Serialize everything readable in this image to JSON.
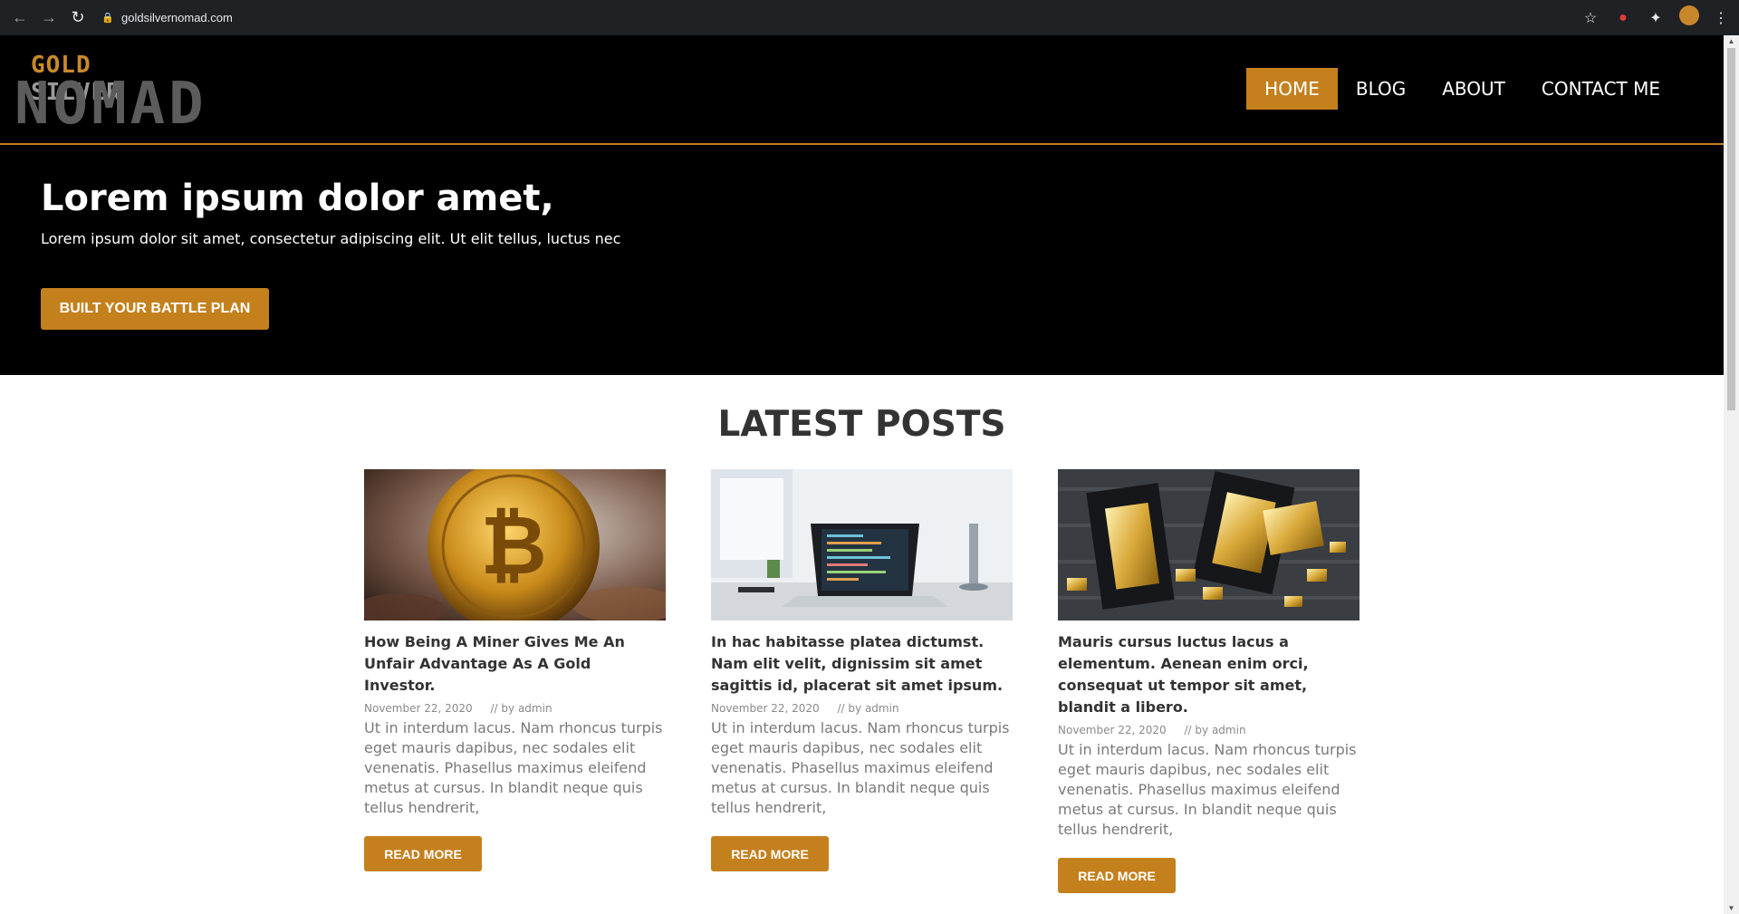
{
  "browser": {
    "url": "goldsilvernomad.com"
  },
  "logo": {
    "word1": "GOLD",
    "word2": "SILVER",
    "word3": "NOMAD"
  },
  "nav": {
    "items": [
      {
        "label": "HOME",
        "active": true
      },
      {
        "label": "BLOG",
        "active": false
      },
      {
        "label": "ABOUT",
        "active": false
      },
      {
        "label": "CONTACT ME",
        "active": false
      }
    ]
  },
  "hero": {
    "title": "Lorem ipsum dolor amet,",
    "subtitle": "Lorem ipsum dolor sit amet, consectetur adipiscing elit. Ut elit tellus, luctus nec",
    "cta": "BUILT YOUR BATTLE PLAN"
  },
  "posts_section": {
    "title": "LATEST POSTS",
    "posts": [
      {
        "title": "How Being A Miner Gives Me An Unfair Advantage As A Gold Investor.",
        "date": "November 22, 2020",
        "author": "// by admin",
        "excerpt": "Ut in interdum lacus. Nam rhoncus turpis eget mauris dapibus, nec sodales elit venenatis. Phasellus maximus eleifend metus at cursus. In blandit neque quis tellus hendrerit,",
        "button": "READ MORE"
      },
      {
        "title": "In hac habitasse platea dictumst. Nam elit velit, dignissim sit amet sagittis id, placerat sit amet ipsum.",
        "date": "November 22, 2020",
        "author": "// by admin",
        "excerpt": "Ut in interdum lacus. Nam rhoncus turpis eget mauris dapibus, nec sodales elit venenatis. Phasellus maximus eleifend metus at cursus. In blandit neque quis tellus hendrerit,",
        "button": "READ MORE"
      },
      {
        "title": "Mauris cursus luctus lacus a elementum. Aenean enim orci, consequat ut tempor sit amet, blandit a libero.",
        "date": "November 22, 2020",
        "author": "// by admin",
        "excerpt": "Ut in interdum lacus. Nam rhoncus turpis eget mauris dapibus, nec sodales elit venenatis. Phasellus maximus eleifend metus at cursus. In blandit neque quis tellus hendrerit,",
        "button": "READ MORE"
      }
    ]
  },
  "colors": {
    "accent": "#c5801e",
    "header_bg": "#000000",
    "heading_text": "#333333",
    "body_text": "#7a7a7a"
  }
}
